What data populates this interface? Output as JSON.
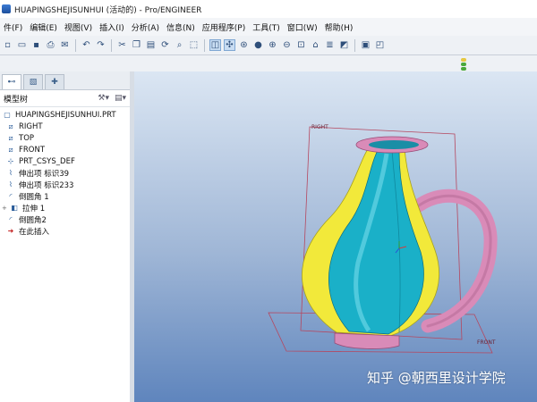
{
  "window": {
    "title": "HUAPINGSHEJISUNHUI (活动的) - Pro/ENGINEER"
  },
  "menu": [
    "件(F)",
    "编辑(E)",
    "视图(V)",
    "插入(I)",
    "分析(A)",
    "信息(N)",
    "应用程序(P)",
    "工具(T)",
    "窗口(W)",
    "帮助(H)"
  ],
  "toolbar_icons": [
    "new-icon",
    "open-icon",
    "save-icon",
    "print-icon",
    "email-icon",
    "undo-icon",
    "redo-icon",
    "cut-icon",
    "copy-icon",
    "paste-icon",
    "regenerate-icon",
    "find-icon",
    "select-icon",
    "datum-display-icon",
    "spin-center-icon",
    "saved-views-icon",
    "shading-icon",
    "zoom-in-icon",
    "zoom-out-icon",
    "refit-icon",
    "orient-icon",
    "layers-icon",
    "appearance-icon",
    "view-manager-icon"
  ],
  "panel": {
    "header": "模型树",
    "tabs": [
      "model-tree-tab",
      "folder-tab",
      "favorites-tab"
    ]
  },
  "tree": [
    {
      "label": "HUAPINGSHEJISUNHUI.PRT",
      "icon": "part-icon"
    },
    {
      "label": "RIGHT",
      "icon": "datum-plane-icon"
    },
    {
      "label": "TOP",
      "icon": "datum-plane-icon"
    },
    {
      "label": "FRONT",
      "icon": "datum-plane-icon"
    },
    {
      "label": "PRT_CSYS_DEF",
      "icon": "csys-icon"
    },
    {
      "label": "伸出项 标识39",
      "icon": "protrusion-icon"
    },
    {
      "label": "伸出项 标识233",
      "icon": "protrusion-icon"
    },
    {
      "label": "倒圆角 1",
      "icon": "round-icon"
    },
    {
      "label": "拉伸 1",
      "icon": "extrude-icon"
    },
    {
      "label": "倒圆角2",
      "icon": "round-icon"
    },
    {
      "label": "在此插入",
      "icon": "insert-here-icon"
    }
  ],
  "viewport": {
    "datum_labels": {
      "right": "RIGHT",
      "front": "FRONT"
    },
    "colors": {
      "body": "#1ab0c8",
      "accent": "#f2e93a",
      "handle": "#d98bb8",
      "datum": "#b5475f"
    }
  },
  "watermark": "知乎 @朝西里设计学院"
}
